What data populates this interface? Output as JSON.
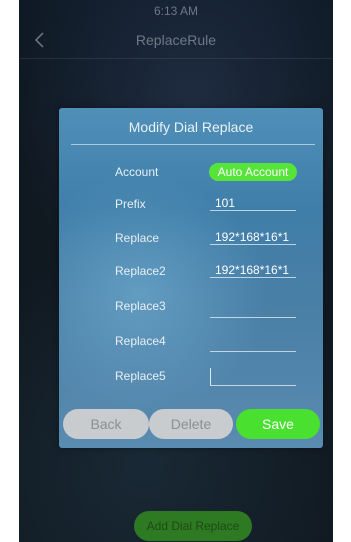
{
  "status_bar": {
    "time": "6:13 AM"
  },
  "nav": {
    "title": "ReplaceRule",
    "back_icon": "chevron-left-icon"
  },
  "dialog": {
    "title": "Modify Dial Replace",
    "account": {
      "label": "Account",
      "value": "Auto Account"
    },
    "prefix": {
      "label": "Prefix",
      "value": "101"
    },
    "replace": {
      "label": "Replace",
      "value": "192*168*16*1"
    },
    "replace2": {
      "label": "Replace2",
      "value": "192*168*16*1"
    },
    "replace3": {
      "label": "Replace3",
      "value": ""
    },
    "replace4": {
      "label": "Replace4",
      "value": ""
    },
    "replace5": {
      "label": "Replace5",
      "value": ""
    },
    "buttons": {
      "back": "Back",
      "delete": "Delete",
      "save": "Save"
    }
  },
  "footer": {
    "add_label": "Add Dial Replace"
  },
  "colors": {
    "accent_green": "#49e02f",
    "dialog_blue": "#4a86b0",
    "button_gray": "#c9ccce"
  }
}
